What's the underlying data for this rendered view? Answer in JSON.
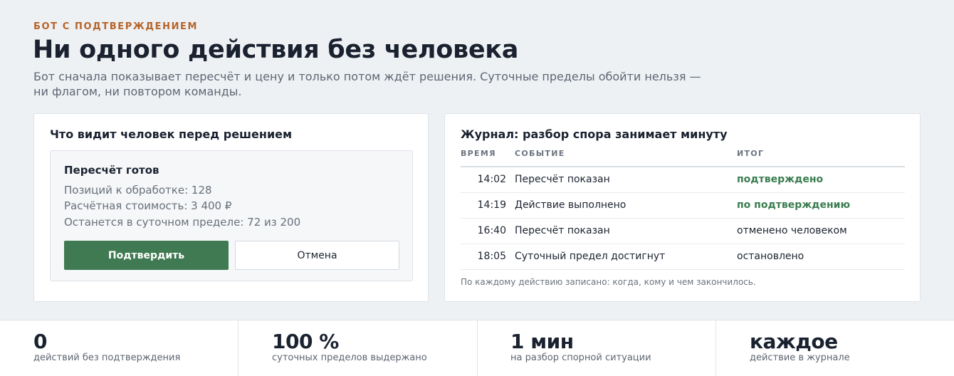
{
  "header": {
    "eyebrow": "БОТ С ПОДТВЕРЖДЕНИЕМ",
    "title": "Ни одного действия без человека",
    "subtitle": "Бот сначала показывает пересчёт и цену и только потом ждёт решения. Суточные пределы обойти нельзя — ни флагом, ни повтором команды."
  },
  "decision_card": {
    "title": "Что видит человек перед решением",
    "panel": {
      "title": "Пересчёт готов",
      "lines": [
        "Позиций к обработке: 128",
        "Расчётная стоимость: 3 400 ₽",
        "Останется в суточном пределе: 72 из 200"
      ],
      "confirm_label": "Подтвердить",
      "cancel_label": "Отмена"
    }
  },
  "log_card": {
    "title": "Журнал: разбор спора занимает минуту",
    "columns": [
      "ВРЕМЯ",
      "СОБЫТИЕ",
      "ИТОГ"
    ],
    "rows": [
      {
        "time": "14:02",
        "event": "Пересчёт показан",
        "result": "подтверждено",
        "status": "ok"
      },
      {
        "time": "14:19",
        "event": "Действие выполнено",
        "result": "по подтверждению",
        "status": "ok"
      },
      {
        "time": "16:40",
        "event": "Пересчёт показан",
        "result": "отменено человеком",
        "status": "neutral"
      },
      {
        "time": "18:05",
        "event": "Суточный предел достигнут",
        "result": "остановлено",
        "status": "neutral"
      }
    ],
    "note": "По каждому действию записано: когда, кому и чем закончилось."
  },
  "stats": [
    {
      "value": "0",
      "label": "действий без подтверждения"
    },
    {
      "value": "100 %",
      "label": "суточных пределов выдержано"
    },
    {
      "value": "1 мин",
      "label": "на разбор спорной ситуации"
    },
    {
      "value": "каждое",
      "label": "действие в журнале"
    }
  ],
  "colors": {
    "accent": "#b5652a",
    "confirm": "#3f7a52",
    "ok_text": "#3a7d4f",
    "background": "#eef1f4"
  }
}
